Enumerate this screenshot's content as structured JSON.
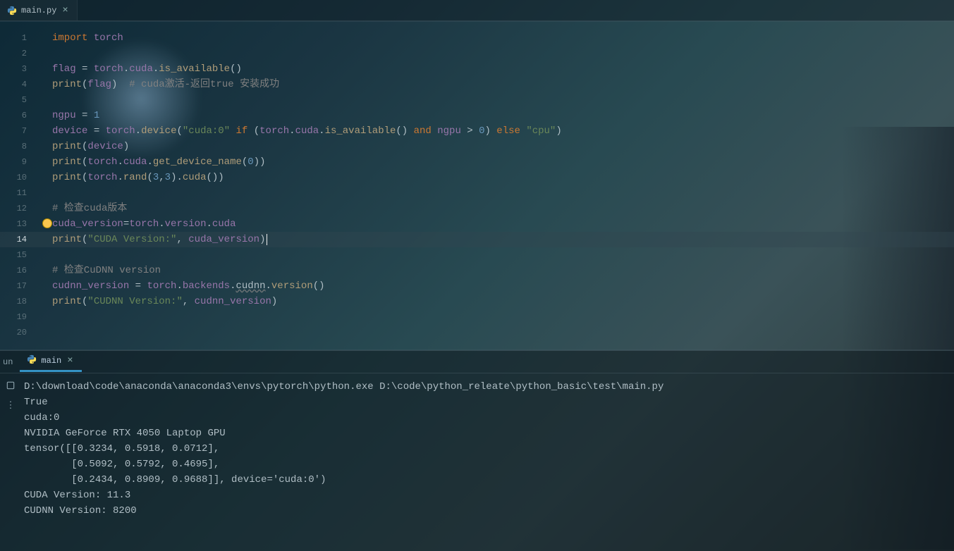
{
  "tab": {
    "filename": "main.py",
    "icon": "python-file-icon"
  },
  "editor": {
    "current_line": 14,
    "lines": [
      {
        "n": 1,
        "tokens": [
          [
            "kw",
            "import"
          ],
          [
            "sp",
            " "
          ],
          [
            "ident",
            "torch"
          ]
        ]
      },
      {
        "n": 2,
        "tokens": []
      },
      {
        "n": 3,
        "tokens": [
          [
            "ident",
            "flag"
          ],
          [
            "op",
            " = "
          ],
          [
            "ident",
            "torch"
          ],
          [
            "op",
            "."
          ],
          [
            "ident",
            "cuda"
          ],
          [
            "op",
            "."
          ],
          [
            "call",
            "is_available"
          ],
          [
            "paren",
            "()"
          ]
        ]
      },
      {
        "n": 4,
        "tokens": [
          [
            "call",
            "print"
          ],
          [
            "paren",
            "("
          ],
          [
            "ident",
            "flag"
          ],
          [
            "paren",
            ")"
          ],
          [
            "sp",
            "  "
          ],
          [
            "cmt",
            "# cuda激活-返回true 安装成功"
          ]
        ]
      },
      {
        "n": 5,
        "tokens": []
      },
      {
        "n": 6,
        "tokens": [
          [
            "ident",
            "ngpu"
          ],
          [
            "op",
            " = "
          ],
          [
            "num",
            "1"
          ]
        ]
      },
      {
        "n": 7,
        "tokens": [
          [
            "ident",
            "device"
          ],
          [
            "op",
            " = "
          ],
          [
            "ident",
            "torch"
          ],
          [
            "op",
            "."
          ],
          [
            "call",
            "device"
          ],
          [
            "paren",
            "("
          ],
          [
            "str",
            "\"cuda:0\""
          ],
          [
            "sp",
            " "
          ],
          [
            "kw",
            "if"
          ],
          [
            "sp",
            " "
          ],
          [
            "paren",
            "("
          ],
          [
            "ident",
            "torch"
          ],
          [
            "op",
            "."
          ],
          [
            "ident",
            "cuda"
          ],
          [
            "op",
            "."
          ],
          [
            "call",
            "is_available"
          ],
          [
            "paren",
            "()"
          ],
          [
            "sp",
            " "
          ],
          [
            "kw",
            "and"
          ],
          [
            "sp",
            " "
          ],
          [
            "ident",
            "ngpu"
          ],
          [
            "op",
            " > "
          ],
          [
            "num",
            "0"
          ],
          [
            "paren",
            ")"
          ],
          [
            "sp",
            " "
          ],
          [
            "kw",
            "else"
          ],
          [
            "sp",
            " "
          ],
          [
            "str",
            "\"cpu\""
          ],
          [
            "paren",
            ")"
          ]
        ]
      },
      {
        "n": 8,
        "tokens": [
          [
            "call",
            "print"
          ],
          [
            "paren",
            "("
          ],
          [
            "ident",
            "device"
          ],
          [
            "paren",
            ")"
          ]
        ]
      },
      {
        "n": 9,
        "tokens": [
          [
            "call",
            "print"
          ],
          [
            "paren",
            "("
          ],
          [
            "ident",
            "torch"
          ],
          [
            "op",
            "."
          ],
          [
            "ident",
            "cuda"
          ],
          [
            "op",
            "."
          ],
          [
            "call",
            "get_device_name"
          ],
          [
            "paren",
            "("
          ],
          [
            "num",
            "0"
          ],
          [
            "paren",
            "))"
          ]
        ]
      },
      {
        "n": 10,
        "tokens": [
          [
            "call",
            "print"
          ],
          [
            "paren",
            "("
          ],
          [
            "ident",
            "torch"
          ],
          [
            "op",
            "."
          ],
          [
            "call",
            "rand"
          ],
          [
            "paren",
            "("
          ],
          [
            "num",
            "3"
          ],
          [
            "op",
            ","
          ],
          [
            "num",
            "3"
          ],
          [
            "paren",
            ")"
          ],
          [
            "op",
            "."
          ],
          [
            "call",
            "cuda"
          ],
          [
            "paren",
            "())"
          ]
        ]
      },
      {
        "n": 11,
        "tokens": []
      },
      {
        "n": 12,
        "tokens": [
          [
            "cmt",
            "# 检查cuda版本"
          ]
        ]
      },
      {
        "n": 13,
        "tokens": [
          [
            "ident",
            "cuda_version"
          ],
          [
            "op",
            "="
          ],
          [
            "ident",
            "torch"
          ],
          [
            "op",
            "."
          ],
          [
            "ident",
            "version"
          ],
          [
            "op",
            "."
          ],
          [
            "ident",
            "cuda"
          ]
        ],
        "bulb": true
      },
      {
        "n": 14,
        "tokens": [
          [
            "call",
            "print"
          ],
          [
            "paren",
            "("
          ],
          [
            "str",
            "\"CUDA Version:\""
          ],
          [
            "op",
            ", "
          ],
          [
            "ident",
            "cuda_version"
          ],
          [
            "paren",
            ")"
          ]
        ],
        "caret": true
      },
      {
        "n": 15,
        "tokens": []
      },
      {
        "n": 16,
        "tokens": [
          [
            "cmt",
            "# 检查CuDNN version"
          ]
        ]
      },
      {
        "n": 17,
        "tokens": [
          [
            "ident",
            "cudnn_version"
          ],
          [
            "op",
            " = "
          ],
          [
            "ident",
            "torch"
          ],
          [
            "op",
            "."
          ],
          [
            "ident",
            "backends"
          ],
          [
            "op",
            "."
          ],
          [
            "wavy",
            "cudnn"
          ],
          [
            "op",
            "."
          ],
          [
            "call",
            "version"
          ],
          [
            "paren",
            "()"
          ]
        ]
      },
      {
        "n": 18,
        "tokens": [
          [
            "call",
            "print"
          ],
          [
            "paren",
            "("
          ],
          [
            "str",
            "\"CUDNN Version:\""
          ],
          [
            "op",
            ", "
          ],
          [
            "ident",
            "cudnn_version"
          ],
          [
            "paren",
            ")"
          ]
        ]
      },
      {
        "n": 19,
        "tokens": []
      },
      {
        "n": 20,
        "tokens": []
      }
    ]
  },
  "run": {
    "panel_label": "un",
    "tab_name": "main",
    "output": [
      "D:\\download\\code\\anaconda\\anaconda3\\envs\\pytorch\\python.exe D:\\code\\python_releate\\python_basic\\test\\main.py",
      "True",
      "cuda:0",
      "NVIDIA GeForce RTX 4050 Laptop GPU",
      "tensor([[0.3234, 0.5918, 0.0712],",
      "        [0.5092, 0.5792, 0.4695],",
      "        [0.2434, 0.8909, 0.9688]], device='cuda:0')",
      "CUDA Version: 11.3",
      "CUDNN Version: 8200"
    ]
  }
}
